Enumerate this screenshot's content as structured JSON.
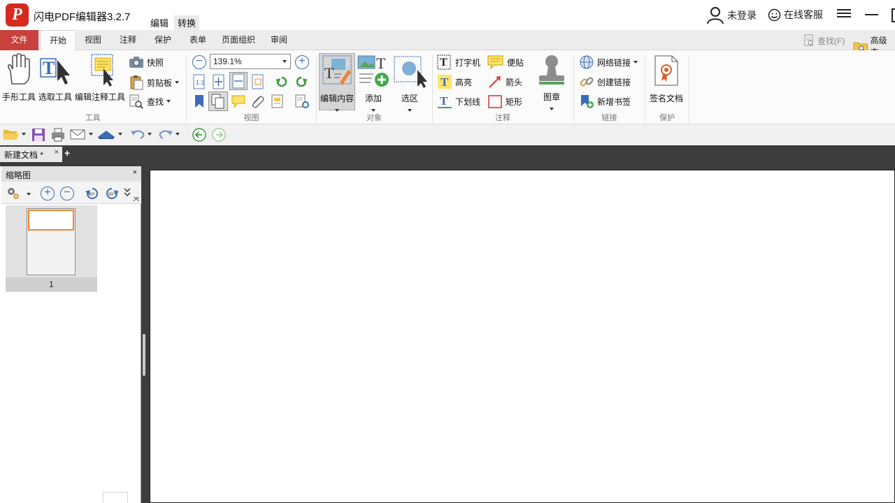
{
  "app": {
    "title": "闪电PDF编辑器3.2.7",
    "logo_letter": "P",
    "title_tabs": [
      "编辑",
      "转换"
    ],
    "user": "未登录",
    "service": "在线客服"
  },
  "colors": {
    "accent_red": "#c9403c",
    "logo_red": "#d62a1f",
    "dark_bg": "#3d3d3d",
    "thumb_highlight": "#f0832f",
    "icon_blue": "#3a6db5"
  },
  "ribbon": {
    "file_tab": "文件",
    "tabs": [
      "开始",
      "视图",
      "注释",
      "保护",
      "表单",
      "页面组织",
      "审阅"
    ],
    "active_tab": "开始",
    "find_label": "查找(F)",
    "advanced_find_label": "高级查",
    "groups": {
      "tools": "工具",
      "view": "视图",
      "objects": "对象",
      "annotations": "注释",
      "links": "链接",
      "protect": "保护"
    },
    "tools": {
      "hand": "手形工具",
      "select": "选取工具",
      "edit_annotation": "编辑注释工具",
      "snapshot": "快照",
      "clipboard": "剪贴板",
      "find": "查找"
    },
    "view": {
      "zoom_value": "139.1%"
    },
    "objects": {
      "edit_content": "编辑内容",
      "add": "添加",
      "select_area": "选区"
    },
    "annotations": {
      "typewriter": "打字机",
      "note": "便贴",
      "highlight": "高亮",
      "arrow": "箭头",
      "underline": "下划线",
      "rectangle": "矩形",
      "stamp": "图章"
    },
    "links": {
      "web_link": "网络链接",
      "create_link": "创建链接",
      "new_bookmark": "新增书签"
    },
    "protect": {
      "sign": "签名文档"
    }
  },
  "document": {
    "tab_label": "新建文档 *",
    "close_glyph": "×",
    "add_glyph": "+"
  },
  "thumbnails": {
    "title": "缩略图",
    "close_glyph": "×",
    "rotate_ccw_label": "90°",
    "rotate_cw_label": "90°",
    "page_number": "1"
  }
}
